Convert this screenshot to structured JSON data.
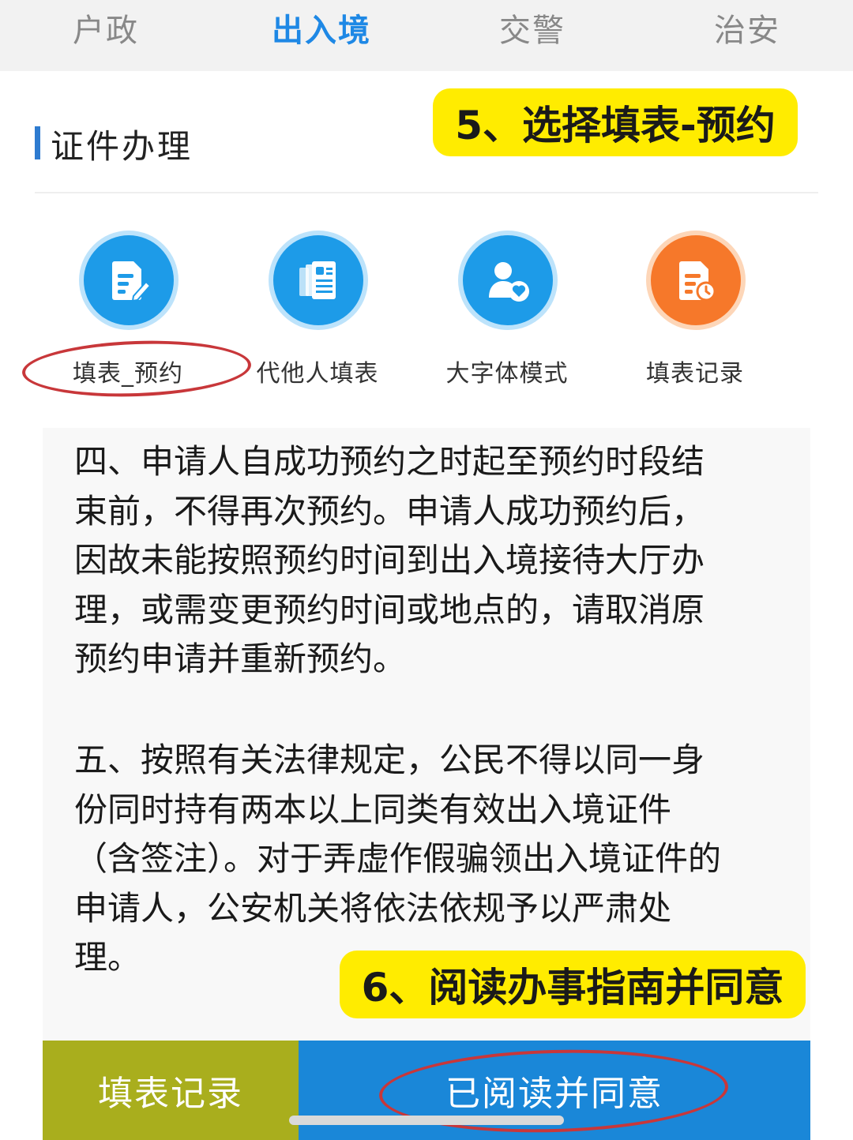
{
  "top_tabs": [
    {
      "label": "户政",
      "active": false
    },
    {
      "label": "出入境",
      "active": true
    },
    {
      "label": "交警",
      "active": false
    },
    {
      "label": "治安",
      "active": false
    }
  ],
  "section": {
    "title": "证件办理"
  },
  "annotations": {
    "step5": "5、选择填表-预约",
    "step6": "6、阅读办事指南并同意"
  },
  "actions": [
    {
      "label": "填表_预约",
      "icon": "edit-form-icon",
      "color": "#1d9be8"
    },
    {
      "label": "代他人填表",
      "icon": "documents-icon",
      "color": "#1d9be8"
    },
    {
      "label": "大字体模式",
      "icon": "user-heart-icon",
      "color": "#1d9be8"
    },
    {
      "label": "填表记录",
      "icon": "form-clock-icon",
      "color": "#f6782a"
    }
  ],
  "guide": {
    "para4": "四、申请人自成功预约之时起至预约时段结\n束前，不得再次预约。申请人成功预约后，\n因故未能按照预约时间到出入境接待大厅办\n理，或需变更预约时间或地点的，请取消原\n预约申请并重新预约。",
    "para5": "五、按照有关法律规定，公民不得以同一身\n份同时持有两本以上同类有效出入境证件\n（含签注）。对于弄虚作假骗领出入境证件的\n申请人，公安机关将依法依规予以严肃处\n理。"
  },
  "bottom_bar": {
    "records_label": "填表记录",
    "agree_label": "已阅读并同意"
  },
  "colors": {
    "accent_blue": "#1e88e5",
    "annotation_yellow": "#ffec00",
    "highlight_red": "#c8373a",
    "records_button": "#a9ae1d",
    "agree_button": "#1a87d8"
  }
}
